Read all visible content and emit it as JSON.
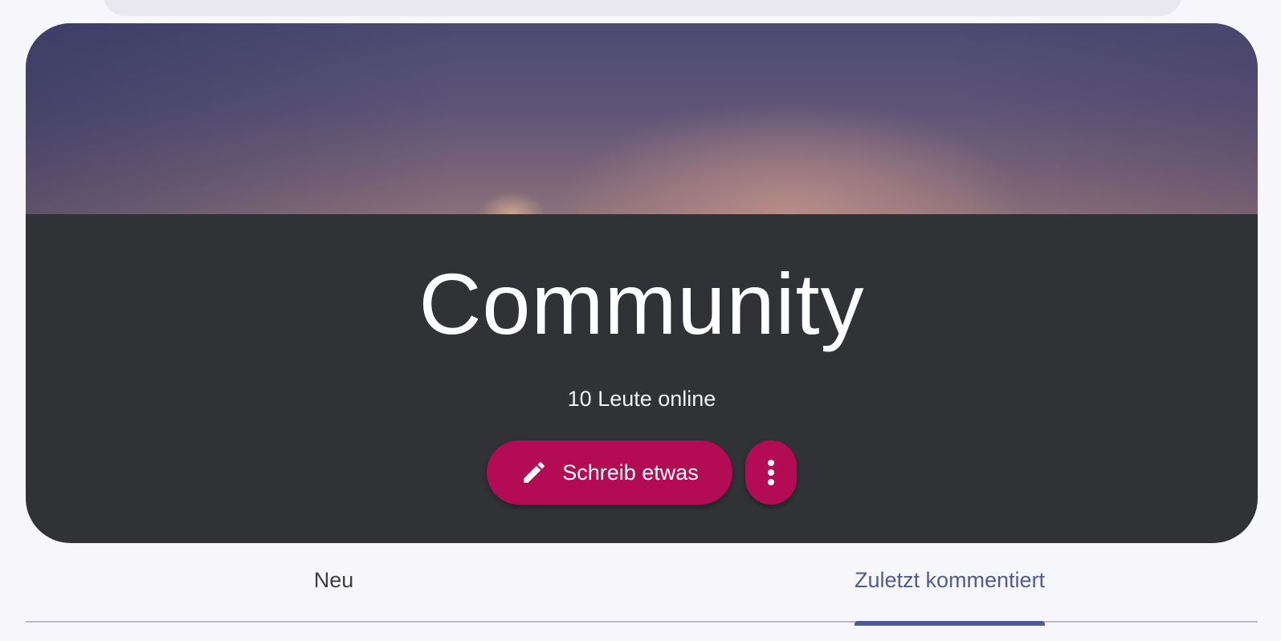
{
  "hero": {
    "title": "Community",
    "online_text": "10 Leute online"
  },
  "actions": {
    "write_label": "Schreib etwas",
    "write_icon": "pencil-icon",
    "more_icon": "more-vertical-icon"
  },
  "tabs": [
    {
      "label": "Neu",
      "active": false
    },
    {
      "label": "Zuletzt kommentiert",
      "active": true
    }
  ],
  "colors": {
    "accent": "#b30c54",
    "tab_active": "#4f5b91",
    "hero_body": "#313236",
    "page_background": "#f7f6fb"
  }
}
